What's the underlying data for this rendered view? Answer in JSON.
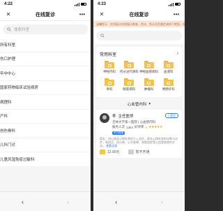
{
  "left": {
    "status_time": "4:22",
    "title": "在线复诊",
    "search_placeholder": "搜索科室",
    "departments": [
      "所有科室",
      "伤口护理",
      "卒中中心",
      "国家药物临床试验病房",
      "病理科",
      "产科",
      "创伤骨科",
      "儿科门诊",
      "儿童风湿免疫过敏科"
    ]
  },
  "right": {
    "status_time": "4:23",
    "title": "在线复诊",
    "banner_text": "温馨提示：在线复诊仅限复诊患者，首诊、急诊及危重症请线下就医，如需帮助请联系客服。",
    "common_title": "常用科室",
    "common_depts": [
      "神经内科",
      "内分泌代谢科",
      "神经血管病科",
      "血液科",
      "骨科",
      "眼底病科",
      "肿瘤科",
      "胃肠外科"
    ],
    "selected_dept": "心血管内科",
    "doctor": {
      "name": "李",
      "title": "主任医师",
      "follow": "关注",
      "hospital": "吉林大学第一医院 | 心血管内科",
      "served_label": "服务人次",
      "served": "1364",
      "rating_label": "好评率",
      "score": "5",
      "stars": "★★★★★",
      "badge": "开方权限",
      "intro": "擅长：冠心病及心律失常的介入治疗，擅长心律失常的诊断与治疗，高血压、冠心病、心力衰竭、高脂血症等心血管疾病的诊治。",
      "more": "查看全部",
      "price1": "12.00元",
      "price2": "暂不开通"
    }
  },
  "colors": {
    "accent": "#2f7cf6",
    "folder": "#f7c24a",
    "star": "#f5a623",
    "banner_bg": "#fbe6d6"
  }
}
